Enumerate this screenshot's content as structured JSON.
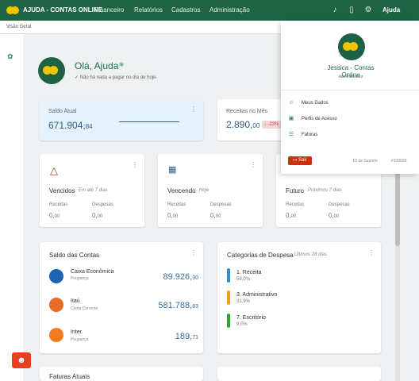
{
  "top": {
    "brand": "AJUDA - CONTAS ONLINE",
    "nav": [
      "Financeiro",
      "Relatórios",
      "Cadastros",
      "Administração"
    ],
    "help": "Ajuda"
  },
  "breadcrumb": "Visão Geral",
  "greeting": {
    "title": "Olá, Ajuda",
    "subtitle": "Não há nada a pagar no dia de hoje."
  },
  "saldo": {
    "label": "Saldo Atual",
    "value_main": "671.904,",
    "value_cents": "84"
  },
  "receitas_mes": {
    "label": "Receitas no Mês",
    "value_main": "2.890,",
    "value_cents": "00",
    "tag": "↓ -23%"
  },
  "vencidos": {
    "title": "Vencidos",
    "subtitle": "Em até 7 dias",
    "receitas": "Receitas",
    "despesas": "Despesas",
    "value_r": "0,",
    "value_r_cents": "00",
    "value_d": "0,",
    "value_d_cents": "00"
  },
  "vencendo": {
    "title": "Vencendo",
    "subtitle": "Hoje",
    "receitas": "Receitas",
    "despesas": "Despesas",
    "value_r": "0,",
    "value_r_cents": "00",
    "value_d": "0,",
    "value_d_cents": "00"
  },
  "futuro": {
    "title": "Futuro",
    "subtitle": "Próximos 7 dias",
    "receitas": "Receitas",
    "despesas": "Despesas",
    "value_r": "0,",
    "value_r_cents": "00",
    "value_d": "0,",
    "value_d_cents": "00"
  },
  "saldo_contas": {
    "title": "Saldo das Contas",
    "accounts": [
      {
        "name": "Caixa Econômica",
        "type": "Poupança",
        "value_main": "89.926,",
        "value_cents": "30"
      },
      {
        "name": "Itaú",
        "type": "Conta Corrente",
        "value_main": "581.788,",
        "value_cents": "83"
      },
      {
        "name": "Inter",
        "type": "Poupança",
        "value_main": "189,",
        "value_cents": "71"
      }
    ]
  },
  "categorias": {
    "title": "Categorias de Despesa",
    "subtitle": "Últimos 28 dias",
    "items": [
      {
        "name": "1. Receita",
        "pct": "59,0%",
        "color": "#2f8fd0"
      },
      {
        "name": "3. Administrativo",
        "pct": "31,9%",
        "color": "#f0a124"
      },
      {
        "name": "7. Escritório",
        "pct": "9,0%",
        "color": "#2fa832"
      }
    ]
  },
  "faturas": {
    "title": "Faturas Atuais"
  },
  "user_menu": {
    "name": "Jessica - Contas Online",
    "role": "Administrador",
    "items": [
      "Meus Dados",
      "Perfis de Acesso",
      "Faturas"
    ],
    "logout": "Sair",
    "support_label": "ID de Suporte",
    "support_id": "#100699"
  },
  "colors": {
    "header": "#1e6344",
    "accent_blue": "#2d5f86",
    "brand_yellow": "#f2c300",
    "logout_red": "#cf2f0f"
  }
}
